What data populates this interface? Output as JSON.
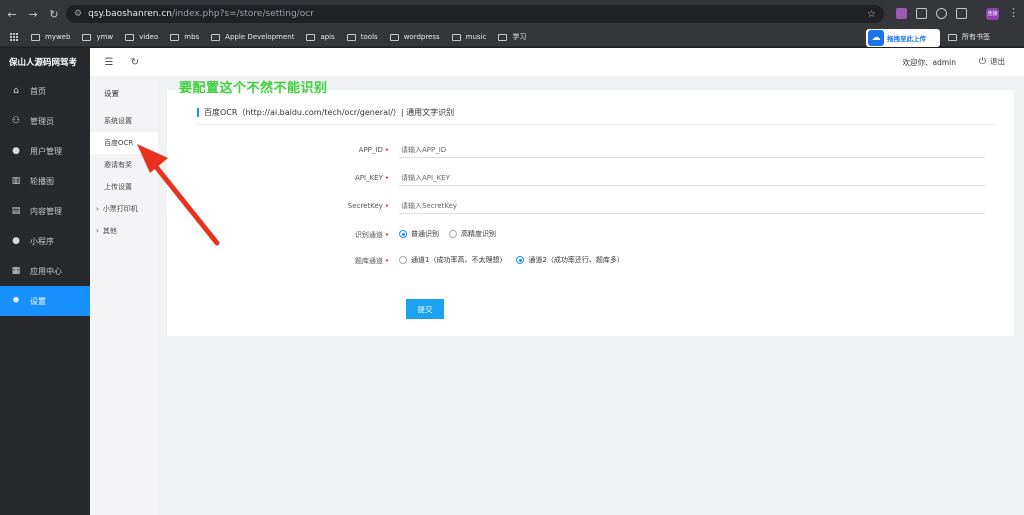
{
  "browser": {
    "url_host": "qsy.baoshanren.cn",
    "url_path": "/index.php?s=/store/setting/ocr",
    "profile_label": "连接",
    "bookmarks": [
      "myweb",
      "ymw",
      "video",
      "mbs",
      "Apple Development",
      "apis",
      "tools",
      "wordpress",
      "music",
      "学习"
    ],
    "all_bookmarks": "所有书签",
    "upload_label": "拖拽至此上传"
  },
  "sidebar": {
    "brand": "保山人源码网驾考",
    "items": [
      {
        "label": "首页",
        "icon": "home-icon",
        "glyph": "⌂"
      },
      {
        "label": "管理员",
        "icon": "admin-icon",
        "glyph": "⚇"
      },
      {
        "label": "用户管理",
        "icon": "user-icon",
        "glyph": "●"
      },
      {
        "label": "轮播图",
        "icon": "carousel-icon",
        "glyph": "▥"
      },
      {
        "label": "内容管理",
        "icon": "content-icon",
        "glyph": "▤"
      },
      {
        "label": "小程序",
        "icon": "miniprogram-icon",
        "glyph": "●"
      },
      {
        "label": "应用中心",
        "icon": "app-center-icon",
        "glyph": "▦"
      },
      {
        "label": "设置",
        "icon": "settings-icon",
        "glyph": "✹"
      }
    ],
    "active_index": 7
  },
  "submenu": {
    "title": "设置",
    "items": [
      "系统设置",
      "百度OCR",
      "邀请有奖",
      "上传设置",
      "小票打印机",
      "其他"
    ],
    "active_index": 1
  },
  "topbar": {
    "welcome": "欢迎你、admin",
    "logout": "退出"
  },
  "card": {
    "title": "百度OCR（http://ai.baidu.com/tech/ocr/general/）| 通用文字识别",
    "fields": [
      {
        "label": "APP_ID",
        "placeholder": "请输入APP_ID"
      },
      {
        "label": "API_KEY",
        "placeholder": "请输入API_KEY"
      },
      {
        "label": "SecretKey",
        "placeholder": "请输入SecretKey"
      }
    ],
    "channel_label": "识别通道",
    "channel_options": [
      "普通识别",
      "高精度识别"
    ],
    "channel_selected": 0,
    "bank_label": "题库通道",
    "bank_options": [
      "通道1（成功率高、不太理想）",
      "通道2（成功率还行、题库多）"
    ],
    "bank_selected": 1,
    "submit_label": "提交"
  },
  "annotation": {
    "text": "要配置这个不然不能识别",
    "color": "#3dd13d",
    "arrow_color": "#e8321e"
  },
  "colors": {
    "accent": "#1890ff",
    "sidebar_bg": "#28292d",
    "required": "#e02020"
  }
}
